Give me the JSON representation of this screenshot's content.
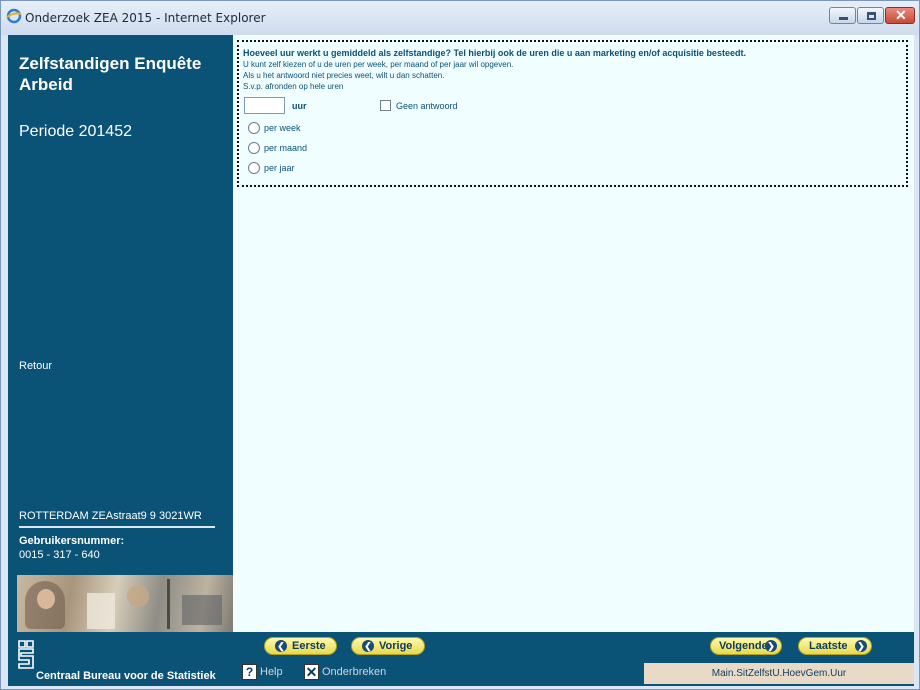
{
  "window": {
    "title": "Onderzoek ZEA 2015 - Internet Explorer"
  },
  "sidebar": {
    "study_title": "Zelfstandigen Enquête Arbeid",
    "period": "Periode 201452",
    "return_link": "Retour",
    "address": "ROTTERDAM ZEAstraat9 9 3021WR",
    "user_label": "Gebruikersnummer:",
    "user_number": "0015 - 317 - 640",
    "org_name": "Centraal Bureau voor de Statistiek"
  },
  "question": {
    "title": "Hoeveel uur werkt u gemiddeld als zelfstandige? Tel hierbij ook de uren die u aan marketing en/of acquisitie besteedt.",
    "help_lines": [
      "U kunt zelf kiezen of u de uren per week, per maand of per jaar wil opgeven.",
      "Als u het antwoord niet precies weet, wilt u dan schatten.",
      "S.v.p. afronden op hele uren"
    ],
    "hours_value": "",
    "unit_label": "uur",
    "no_answer_label": "Geen antwoord",
    "options": [
      "per week",
      "per maand",
      "per jaar"
    ]
  },
  "navigation": {
    "first": "Eerste",
    "previous": "Vorige",
    "next": "Volgende",
    "last": "Laatste"
  },
  "footer": {
    "help": "Help",
    "abort": "Onderbreken",
    "question_id": "Main.SitZelfstU.HoevGem.Uur"
  },
  "colors": {
    "sidebar": "#0b5277",
    "content_bg": "#f0feff",
    "nav_button": "#f3e870",
    "question_text": "#0b5277"
  }
}
